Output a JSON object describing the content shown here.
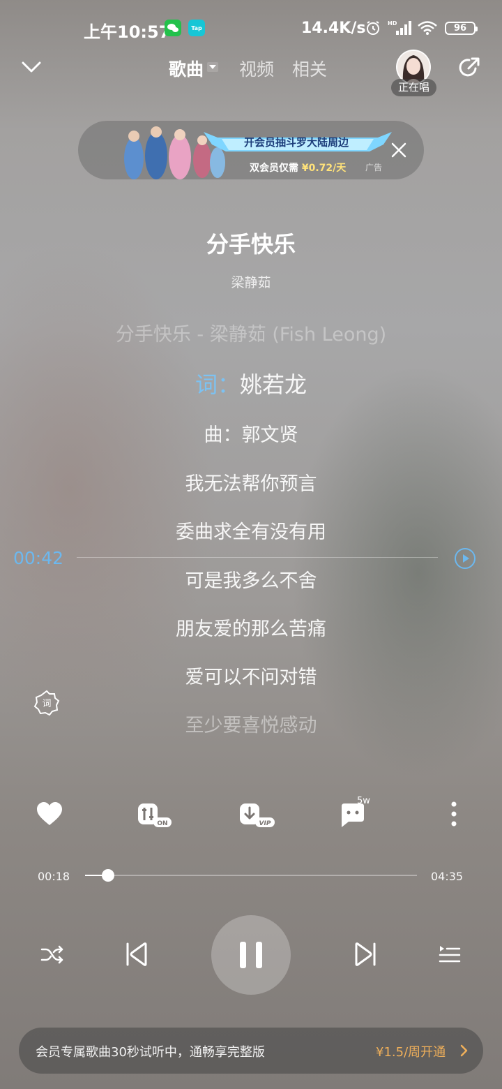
{
  "status_bar": {
    "time": "上午10:57",
    "tap_label": "Tap",
    "net_speed": "14.4K/s",
    "battery": "96"
  },
  "header": {
    "tabs": [
      {
        "label": "歌曲",
        "active": true
      },
      {
        "label": "视频",
        "active": false
      },
      {
        "label": "相关",
        "active": false
      }
    ],
    "singing_badge": "正在唱"
  },
  "ad": {
    "title": "开会员抽斗罗大陆周边",
    "sub_prefix": "双会员仅需",
    "price": "¥0.72/天",
    "label": "广告"
  },
  "song": {
    "title": "分手快乐",
    "artist": "梁静茹"
  },
  "lyrics": {
    "header_line": "分手快乐 - 梁静茹 (Fish Leong)",
    "lyricist_prefix": "词：",
    "lyricist": "姚若龙",
    "lines": [
      "曲：郭文贤",
      "我无法帮你预言",
      "委曲求全有没有用",
      "可是我多么不舍",
      "朋友爱的那么苦痛",
      "爱可以不问对错",
      "至少要喜悦感动"
    ],
    "seek_time": "00:42"
  },
  "actions": {
    "sound_badge": "ON",
    "download_badge": "VIP",
    "comment_count": "5w",
    "lyric_icon_char": "词"
  },
  "progress": {
    "current": "00:18",
    "total": "04:35",
    "fraction": 0.069
  },
  "vip_bar": {
    "text": "会员专属歌曲30秒试听中，通畅享完整版",
    "cta": "¥1.5/周开通"
  },
  "colors": {
    "accent_blue": "#6cb8ef",
    "vip_orange": "#f0b05a",
    "ad_price": "#ffe27a"
  }
}
